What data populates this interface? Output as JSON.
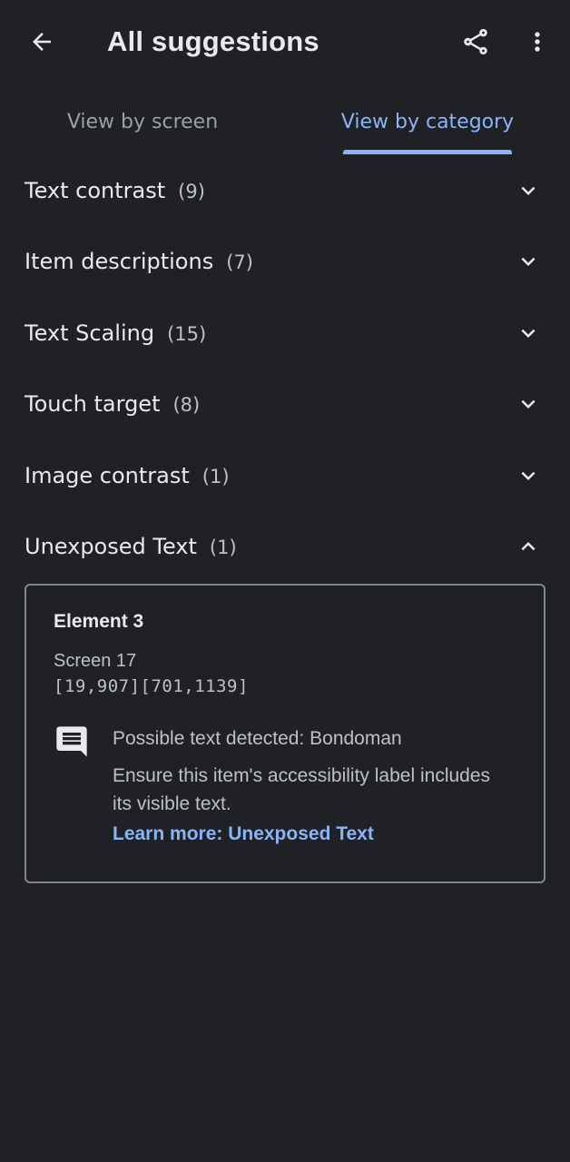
{
  "appbar": {
    "title": "All suggestions",
    "back_icon": "arrow-back-icon",
    "share_icon": "share-icon",
    "more_icon": "more-vert-icon"
  },
  "tabs": [
    {
      "label": "View by screen",
      "selected": false
    },
    {
      "label": "View by category",
      "selected": true
    }
  ],
  "categories": [
    {
      "name": "Text contrast",
      "count": "(9)",
      "expanded": false
    },
    {
      "name": "Item descriptions",
      "count": "(7)",
      "expanded": false
    },
    {
      "name": "Text Scaling",
      "count": "(15)",
      "expanded": false
    },
    {
      "name": "Touch target",
      "count": "(8)",
      "expanded": false
    },
    {
      "name": "Image contrast",
      "count": "(1)",
      "expanded": false
    },
    {
      "name": "Unexposed Text",
      "count": "(1)",
      "expanded": true
    }
  ],
  "card": {
    "element_title": "Element 3",
    "screen": "Screen 17",
    "bounds": "[19,907][701,1139]",
    "detected": "Possible text detected: Bondoman",
    "description": "Ensure this item's accessibility label includes its visible text.",
    "learn_more": "Learn more: Unexposed Text"
  },
  "colors": {
    "background": "#202124",
    "accent": "#8ab4f8",
    "text_primary": "#e8eaed",
    "text_secondary": "#bdc1c6"
  }
}
